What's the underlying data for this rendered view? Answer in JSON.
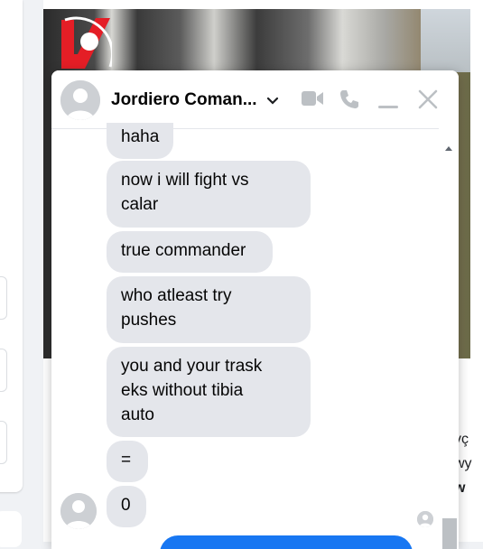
{
  "chat": {
    "contact_name": "Jordiero Coman...",
    "messages": [
      {
        "text_lines": [
          "haha"
        ]
      },
      {
        "text_lines": [
          "now i will fight vs",
          "calar"
        ]
      },
      {
        "text_lines": [
          "true commander"
        ]
      },
      {
        "text_lines": [
          "who atleast try",
          "pushes"
        ]
      },
      {
        "text_lines": [
          "you and your trask",
          "eks without tibia",
          "auto"
        ]
      },
      {
        "text_lines": [
          "="
        ]
      },
      {
        "text_lines": [
          "0"
        ]
      }
    ]
  },
  "background": {
    "right_snippets": [
      "vç",
      "wy",
      "w"
    ]
  },
  "colors": {
    "bubble": "#e4e6eb",
    "icon": "#bcc0c4",
    "accent": "#1877f2",
    "logo_red": "#e41e26"
  },
  "icons": [
    "chevron-down-icon",
    "video-call-icon",
    "phone-icon",
    "minimize-icon",
    "close-icon",
    "scroll-up-icon"
  ]
}
